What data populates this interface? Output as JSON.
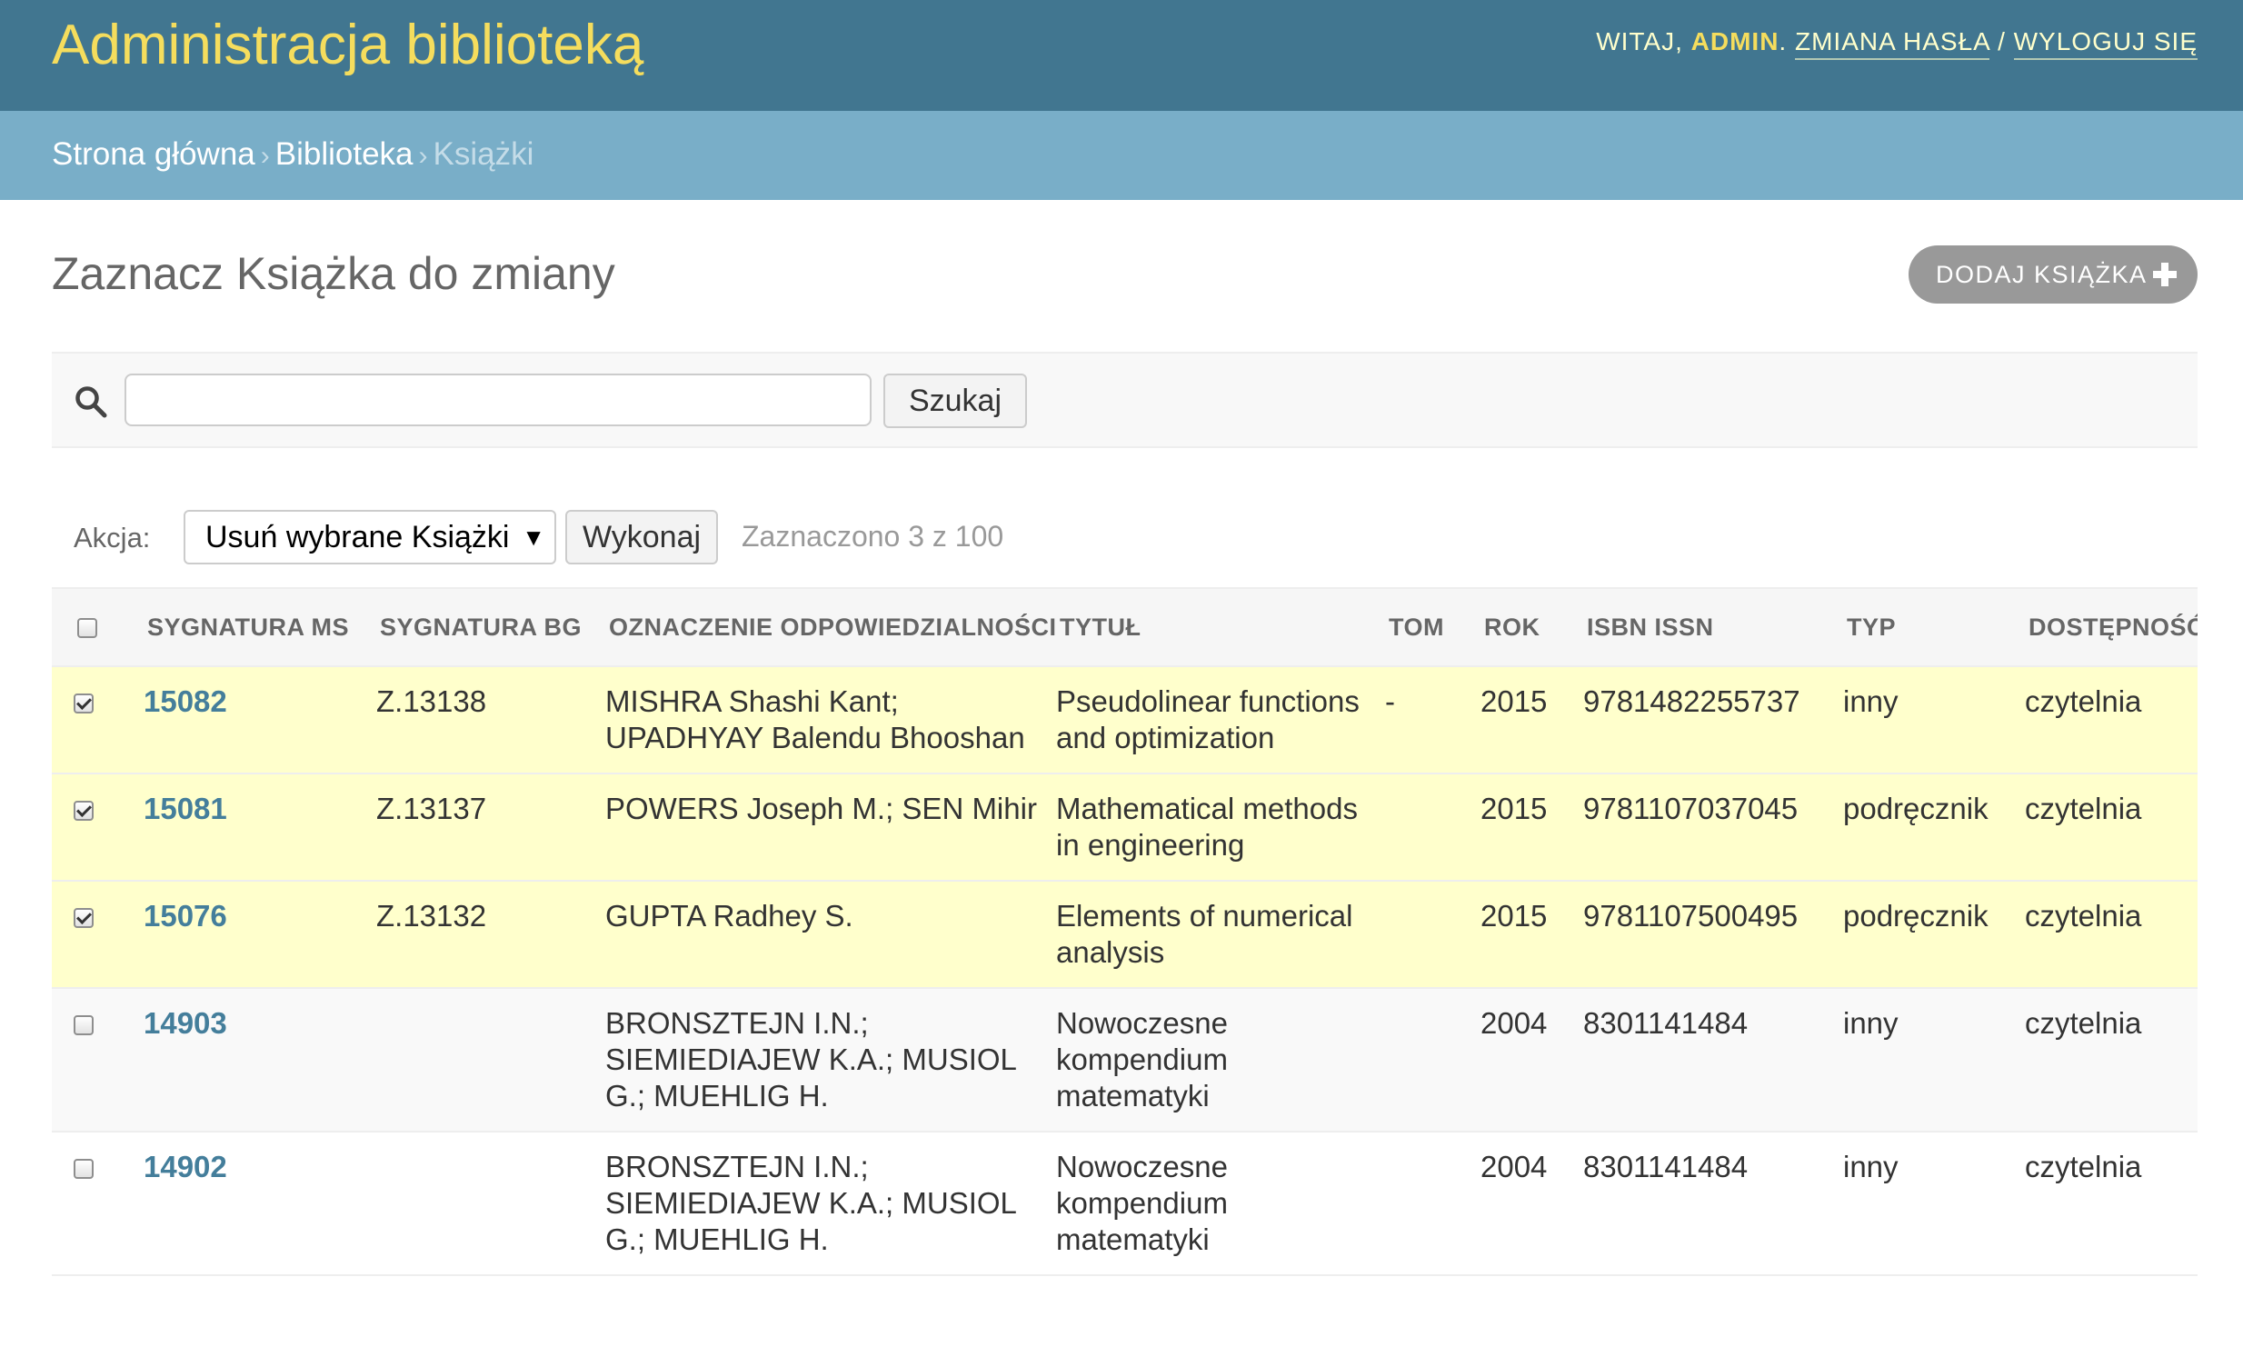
{
  "header": {
    "brand": "Administracja biblioteką",
    "welcome": "WITAJ,",
    "username": "ADMIN",
    "change_password": "ZMIANA HASŁA",
    "separator": "/",
    "logout": "WYLOGUJ SIĘ"
  },
  "breadcrumbs": {
    "home": "Strona główna",
    "app": "Biblioteka",
    "current": "Książki",
    "separator": "›"
  },
  "page": {
    "title": "Zaznacz Książka do zmiany",
    "add_button": "DODAJ KSIĄŻKA"
  },
  "search": {
    "value": "",
    "button": "Szukaj"
  },
  "actions": {
    "label": "Akcja:",
    "selected_option": "Usuń wybrane Książki",
    "go_button": "Wykonaj",
    "counter": "Zaznaczono 3 z 100"
  },
  "table": {
    "columns": [
      "SYGNATURA MS",
      "SYGNATURA BG",
      "OZNACZENIE ODPOWIEDZIALNOŚCI",
      "TYTUŁ",
      "TOM",
      "ROK",
      "ISBN ISSN",
      "TYP",
      "DOSTĘPNOŚĆ"
    ],
    "rows": [
      {
        "checked": true,
        "ms": "15082",
        "bg": "Z.13138",
        "resp": "MISHRA Shashi Kant; UPADHYAY Balendu Bhooshan",
        "title": "Pseudolinear functions and optimization",
        "tom": "-",
        "rok": "2015",
        "isbn": "9781482255737",
        "typ": "inny",
        "dost": "czytelnia"
      },
      {
        "checked": true,
        "ms": "15081",
        "bg": "Z.13137",
        "resp": "POWERS Joseph M.; SEN Mihir",
        "title": "Mathematical methods in engineering",
        "tom": "",
        "rok": "2015",
        "isbn": "9781107037045",
        "typ": "podręcznik",
        "dost": "czytelnia"
      },
      {
        "checked": true,
        "ms": "15076",
        "bg": "Z.13132",
        "resp": "GUPTA Radhey S.",
        "title": "Elements of numerical analysis",
        "tom": "",
        "rok": "2015",
        "isbn": "9781107500495",
        "typ": "podręcznik",
        "dost": "czytelnia"
      },
      {
        "checked": false,
        "ms": "14903",
        "bg": "",
        "resp": "BRONSZTEJN I.N.; SIEMIEDIAJEW K.A.; MUSIOL G.; MUEHLIG H.",
        "title": "Nowoczesne kompendium matematyki",
        "tom": "",
        "rok": "2004",
        "isbn": "8301141484",
        "typ": "inny",
        "dost": "czytelnia"
      },
      {
        "checked": false,
        "ms": "14902",
        "bg": "",
        "resp": "BRONSZTEJN I.N.; SIEMIEDIAJEW K.A.; MUSIOL G.; MUEHLIG H.",
        "title": "Nowoczesne kompendium matematyki",
        "tom": "",
        "rok": "2004",
        "isbn": "8301141484",
        "typ": "inny",
        "dost": "czytelnia"
      }
    ]
  },
  "colors": {
    "header_bg": "#417690",
    "brand": "#f5dd5d",
    "breadcrumbs_bg": "#79aec8",
    "link": "#447e9b",
    "selected_row": "#ffffcc"
  }
}
